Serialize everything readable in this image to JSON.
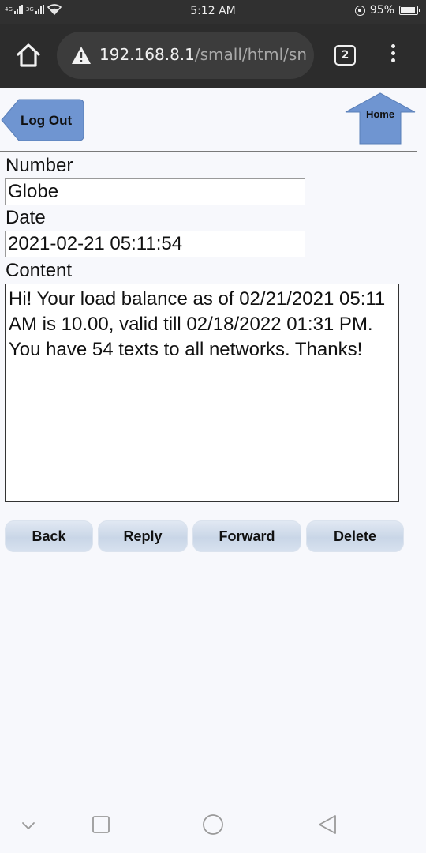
{
  "status_bar": {
    "network_top": "4G",
    "network_bottom": "3G",
    "time": "5:12 AM",
    "battery": "95%",
    "battery_level": 0.95
  },
  "browser": {
    "url_host": "192.168.8.1",
    "url_path": "/small/html/sn",
    "tab_count": "2",
    "icons": [
      "home-icon",
      "warning-icon",
      "tabs-icon",
      "overflow-menu-icon"
    ]
  },
  "page": {
    "logout_label": "Log Out",
    "home_label": "Home",
    "number_label": "Number",
    "number_value": "Globe",
    "date_label": "Date",
    "date_value": "2021-02-21 05:11:54",
    "content_label": "Content",
    "content_value": "Hi! Your load balance as of 02/21/2021 05:11 AM is 10.00, valid till 02/18/2022 01:31 PM. You have 54 texts to all networks. Thanks!",
    "buttons": {
      "back": "Back",
      "reply": "Reply",
      "forward": "Forward",
      "delete": "Delete"
    },
    "colors": {
      "button_blue": "#6f95d1",
      "action_button": "#c9d6e7"
    }
  },
  "nav_bar": {
    "icons": [
      "chevron-down-icon",
      "recents-icon",
      "home-circle-icon",
      "back-triangle-icon"
    ]
  }
}
